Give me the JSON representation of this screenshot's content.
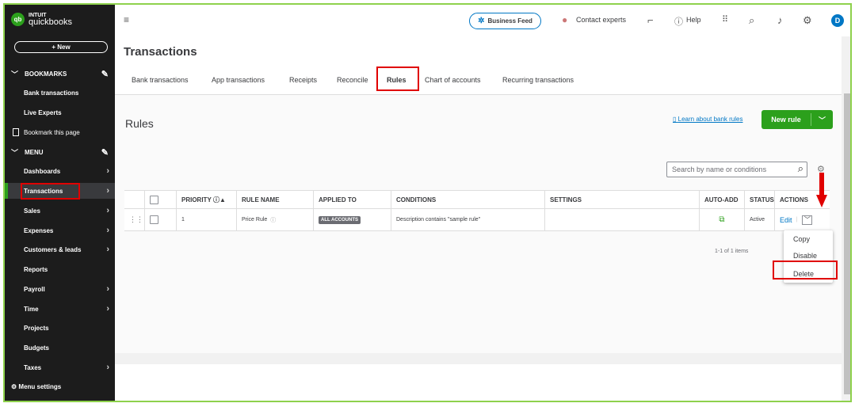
{
  "app": {
    "logo_top": "INTUIT",
    "logo_bottom": "quickbooks",
    "logo_mark": "qb",
    "new_label": "+ New"
  },
  "sidebar": {
    "bookmarks_label": "BOOKMARKS",
    "bookmark_items": [
      {
        "label": "Bank transactions"
      },
      {
        "label": "Live Experts"
      }
    ],
    "bookmark_page_label": "Bookmark this page",
    "menu_label": "MENU",
    "menu_items": [
      {
        "label": "Dashboards"
      },
      {
        "label": "Transactions"
      },
      {
        "label": "Sales"
      },
      {
        "label": "Expenses"
      },
      {
        "label": "Customers & leads"
      },
      {
        "label": "Reports"
      },
      {
        "label": "Payroll"
      },
      {
        "label": "Time"
      },
      {
        "label": "Projects"
      },
      {
        "label": "Budgets"
      },
      {
        "label": "Taxes"
      }
    ],
    "active_item": "Transactions",
    "menu_settings_label": "Menu settings"
  },
  "topbar": {
    "business_feed": "Business Feed",
    "contact": "Contact experts",
    "help": "Help",
    "avatar": "D"
  },
  "page": {
    "title": "Transactions",
    "tabs": [
      {
        "label": "Bank transactions"
      },
      {
        "label": "App transactions"
      },
      {
        "label": "Receipts"
      },
      {
        "label": "Reconcile"
      },
      {
        "label": "Rules"
      },
      {
        "label": "Chart of accounts"
      },
      {
        "label": "Recurring transactions"
      }
    ],
    "active_tab": "Rules"
  },
  "rules": {
    "heading": "Rules",
    "learn_link": "Learn about bank rules",
    "new_rule": "New rule",
    "search_placeholder": "Search by name or conditions",
    "columns": {
      "priority": "PRIORITY",
      "rule_name": "RULE NAME",
      "applied_to": "APPLIED TO",
      "conditions": "CONDITIONS",
      "settings": "SETTINGS",
      "auto_add": "AUTO-ADD",
      "status": "STATUS",
      "actions": "ACTIONS"
    },
    "rows": [
      {
        "priority": "1",
        "rule_name": "Price Rule",
        "applied_to": "ALL ACCOUNTS",
        "conditions": "Description contains \"sample rule\"",
        "settings": "",
        "status": "Active",
        "action": "Edit"
      }
    ],
    "pagination": "1-1 of 1 items",
    "menu": {
      "copy": "Copy",
      "disable": "Disable",
      "delete": "Delete"
    }
  },
  "colors": {
    "brand_green": "#2ca01c",
    "link_blue": "#0077c5",
    "sidebar_bg": "#1c1c1c",
    "highlight_red": "#e00000",
    "frame_green": "#8ed14c"
  }
}
